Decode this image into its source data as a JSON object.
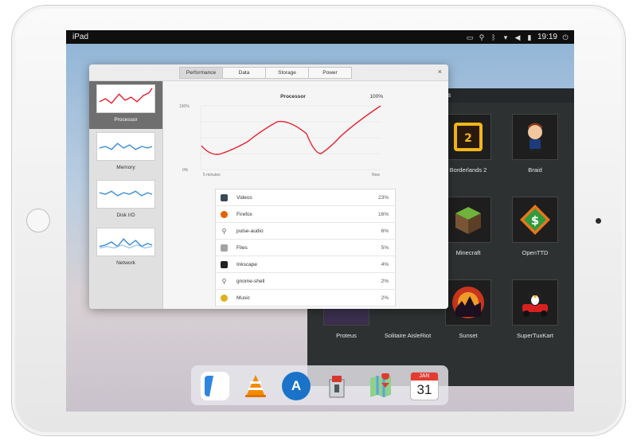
{
  "device_label": "iPad",
  "status_bar": {
    "time": "19:19",
    "icons": [
      "screen-icon",
      "location-icon",
      "bluetooth-icon",
      "network-icon",
      "volume-icon",
      "battery-icon",
      "power-icon"
    ]
  },
  "system_monitor": {
    "tabs": [
      {
        "label": "Performance",
        "active": true
      },
      {
        "label": "Data",
        "active": false
      },
      {
        "label": "Storage",
        "active": false
      },
      {
        "label": "Power",
        "active": false
      }
    ],
    "close_glyph": "×",
    "sidebar": [
      {
        "label": "Processor",
        "active": true
      },
      {
        "label": "Memory",
        "active": false
      },
      {
        "label": "Disk I/O",
        "active": false
      },
      {
        "label": "Network",
        "active": false
      }
    ],
    "processor_chart": {
      "title": "Processor",
      "current": "100%",
      "y_top": "100%",
      "y_bottom": "0%",
      "x_left": "5 minutes",
      "x_right": "Now"
    },
    "processes": [
      {
        "name": "Videos",
        "percent": "23%",
        "icon": "video-icon"
      },
      {
        "name": "Firefox",
        "percent": "16%",
        "icon": "firefox-icon"
      },
      {
        "name": "pulse-audio",
        "percent": "6%",
        "icon": "process-icon"
      },
      {
        "name": "Files",
        "percent": "5%",
        "icon": "files-icon"
      },
      {
        "name": "Inkscape",
        "percent": "4%",
        "icon": "inkscape-icon"
      },
      {
        "name": "gnome-shell",
        "percent": "2%",
        "icon": "process-icon"
      },
      {
        "name": "Music",
        "percent": "2%",
        "icon": "music-icon"
      }
    ]
  },
  "games": {
    "title": "Games",
    "items": [
      {
        "name": "Borderlands 2",
        "icon": "borderlands-icon"
      },
      {
        "name": "Braid",
        "icon": "braid-icon"
      },
      {
        "name": "Minecraft",
        "icon": "minecraft-icon"
      },
      {
        "name": "OpenTTD",
        "icon": "openttd-icon"
      },
      {
        "name": "Proteus",
        "icon": "proteus-icon"
      },
      {
        "name": "Solitaire AisleRiot",
        "icon": "solitaire-icon"
      },
      {
        "name": "Sunset",
        "icon": "sunset-icon"
      },
      {
        "name": "SuperTuxKart",
        "icon": "supertuxkart-icon"
      }
    ]
  },
  "dock": [
    {
      "app": "Files",
      "icon": "files-icon",
      "glyph": ""
    },
    {
      "app": "VLC",
      "icon": "vlc-cone-icon",
      "glyph": ""
    },
    {
      "app": "App Store",
      "icon": "app-store-icon",
      "glyph": "A"
    },
    {
      "app": "Archive Manager",
      "icon": "archive-manager-icon",
      "glyph": ""
    },
    {
      "app": "Maps",
      "icon": "maps-icon",
      "glyph": ""
    },
    {
      "app": "Calendar",
      "icon": "calendar-icon",
      "month": "JAN",
      "day": "31"
    }
  ],
  "colors": {
    "cpu_line": "#e8222f",
    "chart_blue": "#3d8ed8",
    "games_bg": "#2e3132"
  }
}
